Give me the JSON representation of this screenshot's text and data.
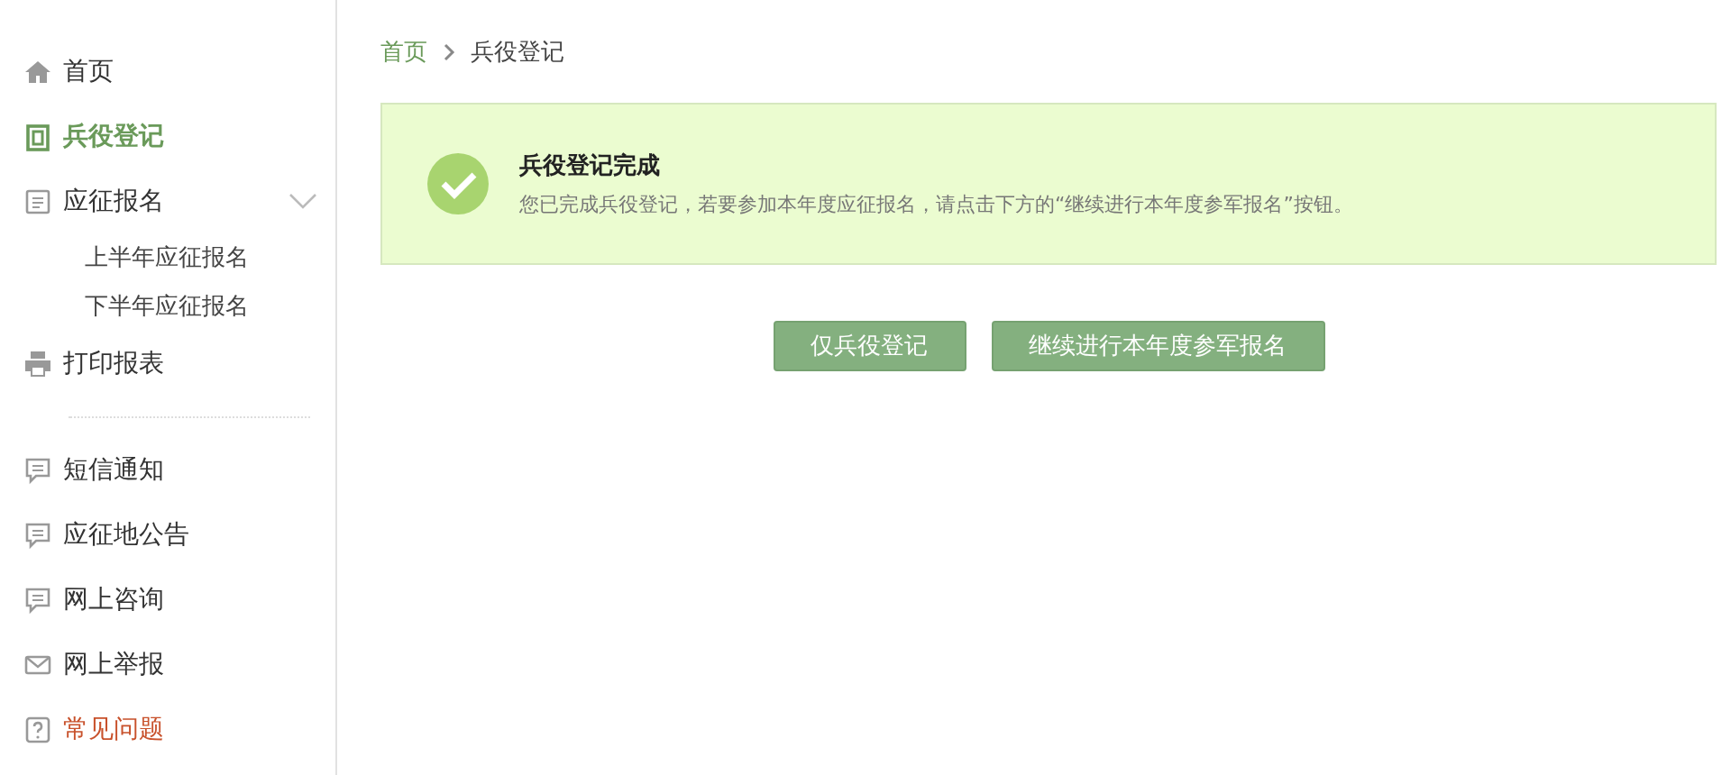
{
  "sidebar": {
    "groups": [
      {
        "items": [
          {
            "label": "首页",
            "selected": false,
            "color": "#333333"
          },
          {
            "label": "兵役登记",
            "selected": true,
            "color": "#6a9a5a"
          },
          {
            "label": "应征报名",
            "selected": false,
            "color": "#333333",
            "expanded": true,
            "children": [
              {
                "label": "上半年应征报名",
                "selected": false
              },
              {
                "label": "下半年应征报名",
                "selected": false
              }
            ]
          },
          {
            "label": "打印报表",
            "selected": false,
            "color": "#333333"
          }
        ]
      },
      {
        "items": [
          {
            "label": "短信通知",
            "selected": false,
            "color": "#333333"
          },
          {
            "label": "应征地公告",
            "selected": false,
            "color": "#333333"
          },
          {
            "label": "网上咨询",
            "selected": false,
            "color": "#333333"
          },
          {
            "label": "网上举报",
            "selected": false,
            "color": "#333333"
          },
          {
            "label": "常见问题",
            "selected": false,
            "color": "#c8512b"
          }
        ]
      }
    ]
  },
  "breadcrumb": [
    "首页",
    "兵役登记"
  ],
  "alert": {
    "title": "兵役登记完成",
    "message": "您已完成兵役登记，若要参加本年度应征报名，请点击下方的“继续进行本年度参军报名”按钮。"
  },
  "buttons": [
    "仅兵役登记",
    "继续进行本年度参军报名"
  ]
}
